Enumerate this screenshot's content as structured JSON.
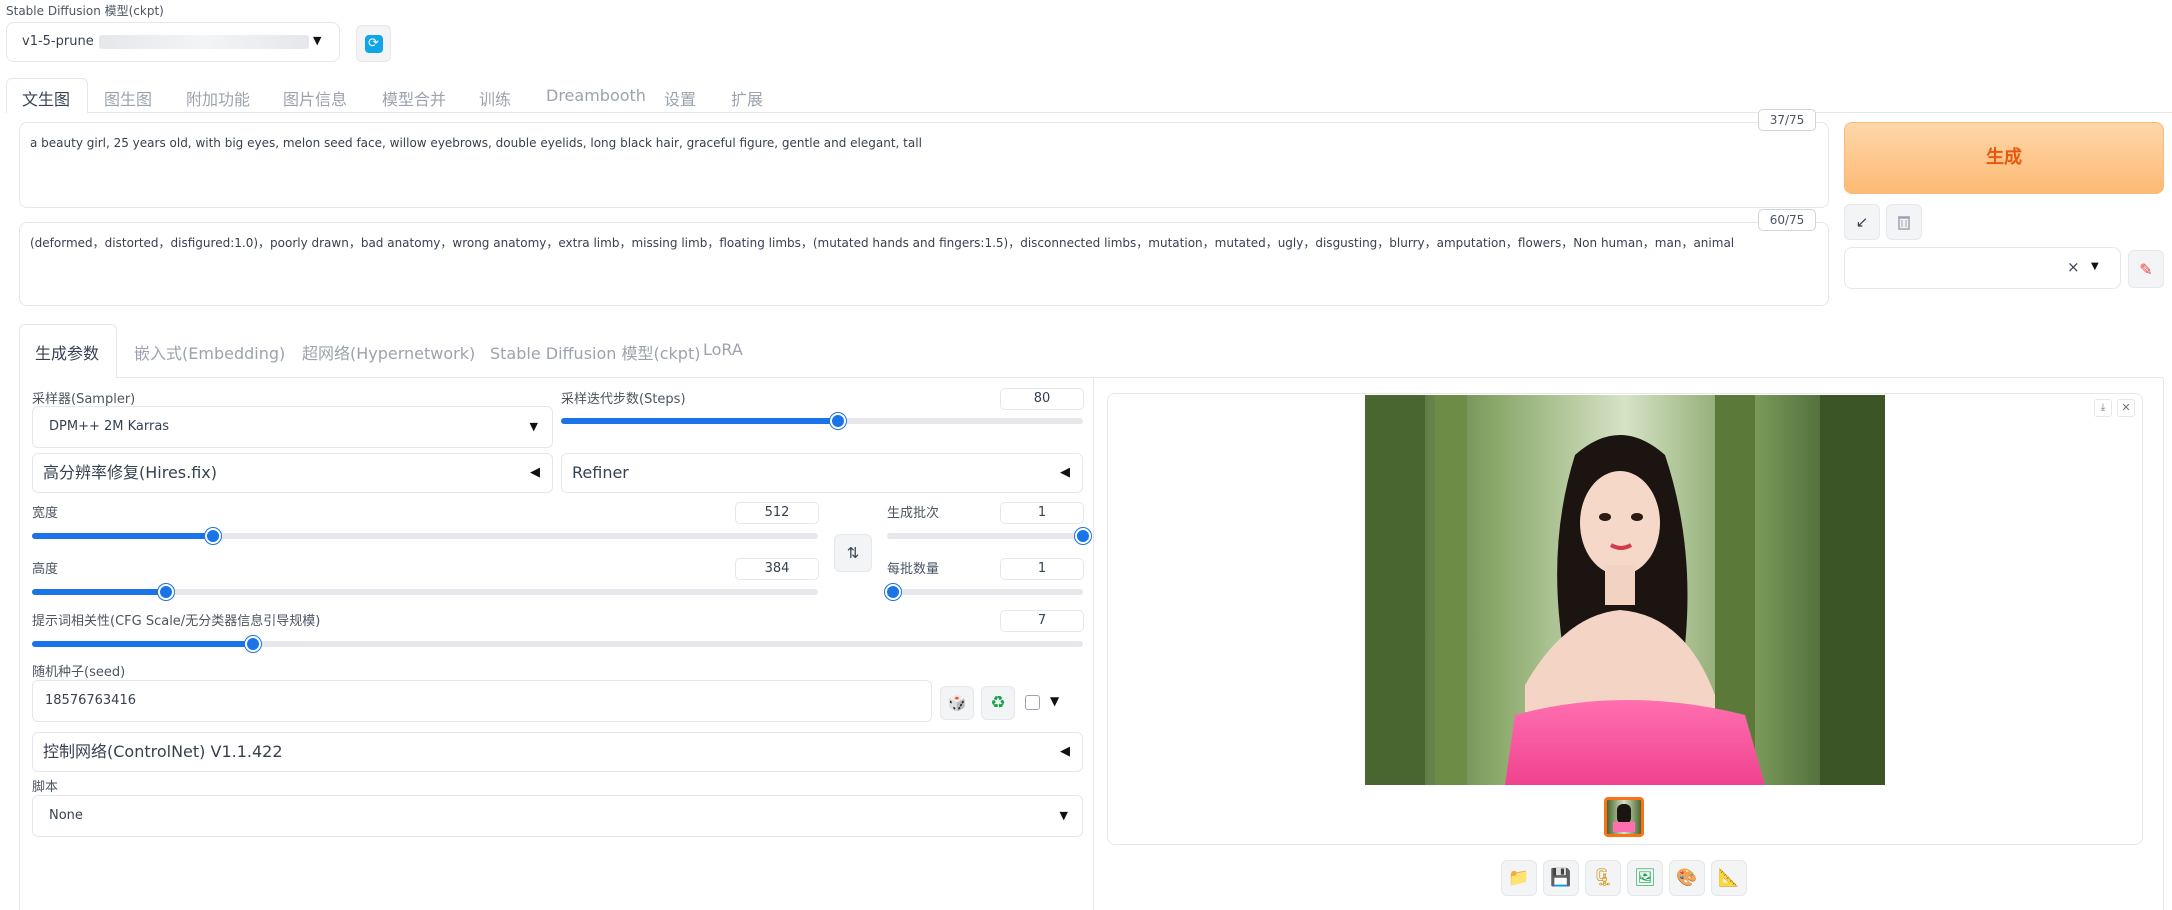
{
  "model": {
    "label": "Stable Diffusion 模型(ckpt)",
    "value": "v1-5-prune",
    "refresh_icon": "refresh-icon"
  },
  "main_tabs": [
    "文生图",
    "图生图",
    "附加功能",
    "图片信息",
    "模型合并",
    "训练",
    "Dreambooth",
    "设置",
    "扩展"
  ],
  "prompt": {
    "text": "a beauty girl, 25 years old, with big eyes, melon seed face, willow eyebrows, double eyelids, long black hair, graceful figure, gentle and elegant, tall",
    "token_count": "37/75"
  },
  "negative_prompt": {
    "text": "(deformed，distorted，disfigured:1.0)，poorly drawn，bad anatomy，wrong anatomy，extra limb，missing limb，floating limbs，(mutated hands and fingers:1.5)，disconnected limbs，mutation，mutated，ugly，disgusting，blurry，amputation，flowers，Non human，man，animal",
    "token_count": "60/75"
  },
  "generate_button": "生成",
  "style_actions": {
    "apply_icon": "arrow-icon",
    "clear_icon": "trash-icon",
    "edit_icon": "pencil-icon",
    "clear_x": "×"
  },
  "sub_tabs": [
    "生成参数",
    "嵌入式(Embedding)",
    "超网络(Hypernetwork)",
    "Stable Diffusion 模型(ckpt)",
    "LoRA"
  ],
  "params": {
    "sampler_label": "采样器(Sampler)",
    "sampler_value": "DPM++ 2M Karras",
    "steps_label": "采样迭代步数(Steps)",
    "steps_value": "80",
    "steps_fraction": 0.53,
    "hires_label": "高分辨率修复(Hires.fix)",
    "refiner_label": "Refiner",
    "width_label": "宽度",
    "width_value": "512",
    "width_fraction": 0.23,
    "height_label": "高度",
    "height_value": "384",
    "height_fraction": 0.17,
    "batch_count_label": "生成批次",
    "batch_count_value": "1",
    "batch_size_label": "每批数量",
    "batch_size_value": "1",
    "swap_icon": "swap-icon",
    "cfg_label": "提示词相关性(CFG Scale/无分类器信息引导规模)",
    "cfg_value": "7",
    "cfg_fraction": 0.21,
    "seed_label": "随机种子(seed)",
    "seed_value": "18576763416",
    "controlnet_label": "控制网络(ControlNet) V1.1.422",
    "script_label": "脚本",
    "script_value": "None"
  },
  "output": {
    "download_icon": "download-icon",
    "close_icon": "close-icon",
    "toolbar_icons": [
      "folder-icon",
      "save-icon",
      "zip-icon",
      "image-icon",
      "palette-icon",
      "ruler-icon"
    ]
  },
  "colors": {
    "accent": "#1a73e8",
    "generate_start": "#fed7aa",
    "generate_end": "#fdba74",
    "generate_text": "#ea580c",
    "thumb_border": "#f97316"
  }
}
